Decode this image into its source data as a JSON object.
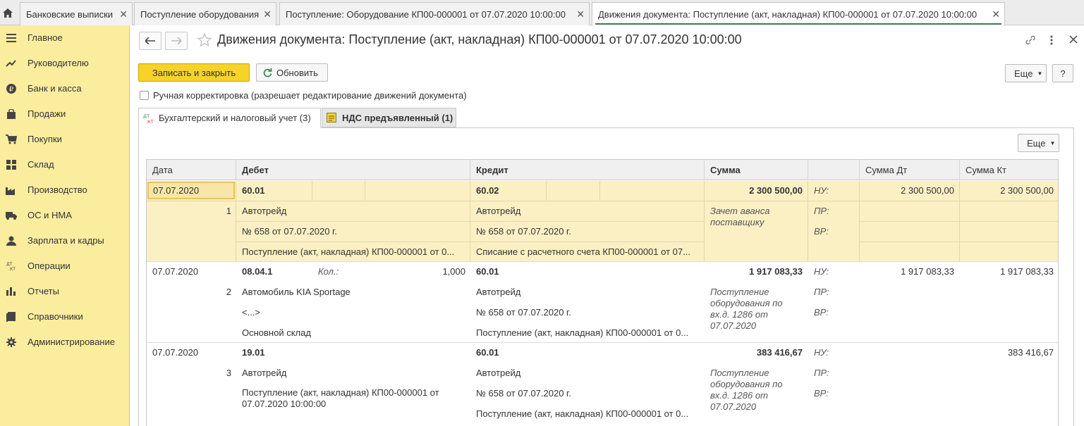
{
  "tabs": [
    {
      "label": "Банковские выписки"
    },
    {
      "label": "Поступление оборудования"
    },
    {
      "label": "Поступление: Оборудование КП00-000001 от 07.07.2020 10:00:00"
    },
    {
      "label": "Движения документа: Поступление (акт, накладная) КП00-000001 от 07.07.2020 10:00:00"
    }
  ],
  "sidebar": {
    "items": [
      {
        "label": "Главное",
        "icon": "menu-icon"
      },
      {
        "label": "Руководителю",
        "icon": "trend-icon"
      },
      {
        "label": "Банк и касса",
        "icon": "ruble-icon"
      },
      {
        "label": "Продажи",
        "icon": "bag-icon"
      },
      {
        "label": "Покупки",
        "icon": "cart-icon"
      },
      {
        "label": "Склад",
        "icon": "grid-icon"
      },
      {
        "label": "Производство",
        "icon": "factory-icon"
      },
      {
        "label": "ОС и НМА",
        "icon": "truck-icon"
      },
      {
        "label": "Зарплата и кадры",
        "icon": "person-icon"
      },
      {
        "label": "Операции",
        "icon": "dt-kt-icon"
      },
      {
        "label": "Отчеты",
        "icon": "bar-chart-icon"
      },
      {
        "label": "Справочники",
        "icon": "book-icon"
      },
      {
        "label": "Администрирование",
        "icon": "gear-icon"
      }
    ]
  },
  "header": {
    "title": "Движения документа: Поступление (акт, накладная) КП00-000001 от 07.07.2020 10:00:00"
  },
  "toolbar": {
    "save_close": "Записать и закрыть",
    "refresh": "Обновить",
    "more": "Еще",
    "help": "?"
  },
  "manual_edit": {
    "label": "Ручная корректировка (разрешает редактирование движений документа)",
    "checked": false
  },
  "form_tabs": [
    {
      "label": "Бухгалтерский и налоговый учет (3)",
      "icon_text": "ДТ КТ"
    },
    {
      "label": "НДС предъявленный (1)"
    }
  ],
  "panel": {
    "more": "Еще"
  },
  "table": {
    "columns": [
      "Дата",
      "Дебет",
      "Кредит",
      "Сумма",
      "",
      "Сумма Дт",
      "Сумма Кт"
    ],
    "rows": [
      {
        "date": "07.07.2020",
        "num": "1",
        "debit": [
          "60.01",
          "Автотрейд",
          "№ 658 от 07.07.2020 г.",
          "Поступление (акт, накладная) КП00-000001 от 0..."
        ],
        "debit_qty_label": "",
        "debit_qty": "",
        "credit": [
          "60.02",
          "Автотрейд",
          "№ 658 от 07.07.2020 г.",
          "Списание с расчетного счета КП00-000001 от 07..."
        ],
        "sum": "2 300 500,00",
        "content": "Зачет аванса поставщику",
        "nu": "НУ:",
        "pr": "ПР:",
        "vr": "ВР:",
        "sum_dt": "2 300 500,00",
        "sum_kt": "2 300 500,00"
      },
      {
        "date": "07.07.2020",
        "num": "2",
        "debit": [
          "08.04.1",
          "Автомобиль KIA Sportage",
          "<...>",
          "Основной склад"
        ],
        "debit_qty_label": "Кол.:",
        "debit_qty": "1,000",
        "credit": [
          "60.01",
          "Автотрейд",
          "№ 658 от 07.07.2020 г.",
          "Поступление (акт, накладная) КП00-000001 от 0..."
        ],
        "sum": "1 917 083,33",
        "content": "Поступление оборудования по вх.д. 1286 от 07.07.2020",
        "nu": "НУ:",
        "pr": "ПР:",
        "vr": "ВР:",
        "sum_dt": "1 917 083,33",
        "sum_kt": "1 917 083,33"
      },
      {
        "date": "07.07.2020",
        "num": "3",
        "debit": [
          "19.01",
          "Автотрейд",
          "Поступление (акт, накладная) КП00-000001 от 07.07.2020 10:00:00",
          ""
        ],
        "debit_qty_label": "",
        "debit_qty": "",
        "credit": [
          "60.01",
          "Автотрейд",
          "№ 658 от 07.07.2020 г.",
          "Поступление (акт, накладная) КП00-000001 от 0..."
        ],
        "sum": "383 416,67",
        "content": "Поступление оборудования по вх.д. 1286 от 07.07.2020",
        "nu": "НУ:",
        "pr": "ПР:",
        "vr": "ВР:",
        "sum_dt": "",
        "sum_kt": "383 416,67"
      }
    ]
  }
}
